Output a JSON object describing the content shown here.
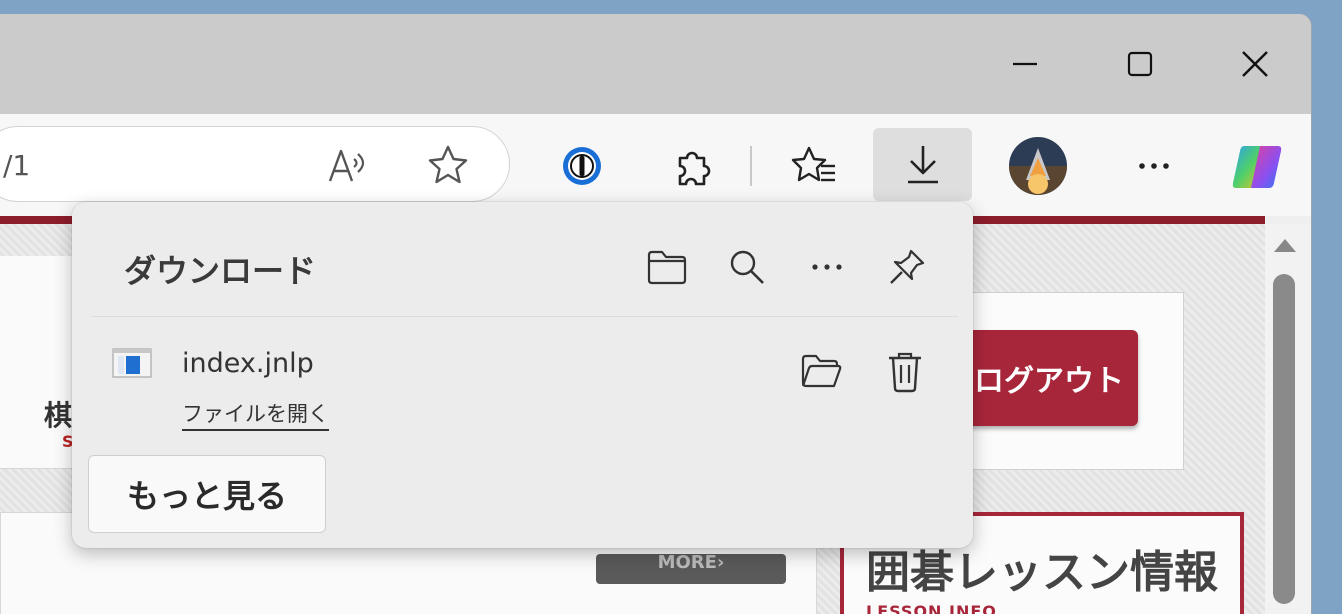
{
  "window": {
    "minimize_icon": "minimize-icon",
    "maximize_icon": "maximize-icon",
    "close_icon": "close-icon"
  },
  "toolbar": {
    "url_fragment": "/1",
    "icons": [
      "read-aloud-icon",
      "favorite-star-icon",
      "password-manager-icon",
      "extensions-icon",
      "favorites-list-icon",
      "downloads-icon",
      "profile-avatar-icon",
      "more-options-icon",
      "copilot-icon"
    ]
  },
  "downloads": {
    "title": "ダウンロード",
    "header_icons": [
      "open-folder-icon",
      "search-icon",
      "more-icon",
      "pin-icon"
    ],
    "items": [
      {
        "name": "index.jnlp",
        "action": "ファイルを開く"
      }
    ],
    "more_label": "もっと見る"
  },
  "page": {
    "left_kanji": "棋",
    "left_sub": "S",
    "more_partial": "MORE›",
    "logout_label": "ログアウト",
    "lesson_title": "囲碁レッスン情報",
    "lesson_sub": "LESSON INFO"
  },
  "colors": {
    "accent_red": "#a8263a",
    "flyout_bg": "#ececec",
    "toolbar_bg": "#f7f7f7",
    "titlebar_bg": "#cbcbcb"
  }
}
